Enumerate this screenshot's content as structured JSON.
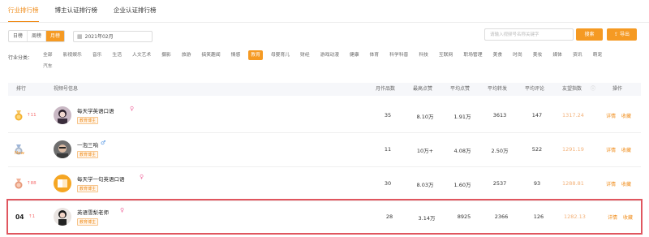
{
  "tabs": [
    "行业排行榜",
    "博主认证排行榜",
    "企业认证排行榜"
  ],
  "period": {
    "options": [
      "日榜",
      "周榜",
      "月榜"
    ],
    "selected": "月榜",
    "date": "2021年02月"
  },
  "search": {
    "placeholder": "请输入视频号名称关键字",
    "button": "搜索",
    "export": "导出"
  },
  "categories": {
    "label": "行业分类：",
    "selected": "教育",
    "items": [
      "全部",
      "影视娱乐",
      "音乐",
      "生活",
      "人文艺术",
      "摄影",
      "旅游",
      "搞笑趣闻",
      "情感",
      "教育",
      "母婴育儿",
      "财经",
      "游戏动漫",
      "健康",
      "体育",
      "科学科普",
      "科技",
      "互联网",
      "职场管理",
      "美食",
      "时尚",
      "美妆",
      "媒体",
      "资讯",
      "萌宠",
      "汽车"
    ]
  },
  "table": {
    "headers": {
      "rank": "排行",
      "info": "视频号信息",
      "works": "月作品数",
      "max_likes": "最高点赞",
      "avg_likes": "平均点赞",
      "avg_shares": "平均转发",
      "avg_comments": "平均评论",
      "index": "友望指数",
      "ops": "操作"
    },
    "index_help_icon": "question-circle-icon",
    "actions": {
      "detail": "详情",
      "favorite": "收藏"
    },
    "rows": [
      {
        "rank_icon": "gold-medal-icon",
        "change": "↑11",
        "name": "每天学英语口语",
        "gender": "♀",
        "tag": "教育博主",
        "works": "35",
        "max_likes": "8.10万",
        "avg_likes": "1.91万",
        "avg_shares": "3613",
        "avg_comments": "147",
        "index": "1317.24"
      },
      {
        "rank_icon": "silver-medal-icon",
        "change": "New",
        "name": "一泡三响",
        "gender": "♂",
        "tag": "教育博主",
        "works": "11",
        "max_likes": "10万+",
        "avg_likes": "4.08万",
        "avg_shares": "2.50万",
        "avg_comments": "522",
        "index": "1291.19"
      },
      {
        "rank_icon": "bronze-medal-icon",
        "change": "↑88",
        "name": "每天学一句英语口语",
        "gender": "♀",
        "tag": "教育博主",
        "works": "30",
        "max_likes": "8.03万",
        "avg_likes": "1.60万",
        "avg_shares": "2537",
        "avg_comments": "93",
        "index": "1288.81"
      },
      {
        "rank": "04",
        "change": "↑1",
        "name": "英语雪梨老师",
        "gender": "♀",
        "tag": "教育博主",
        "works": "28",
        "max_likes": "3.14万",
        "avg_likes": "8925",
        "avg_shares": "2366",
        "avg_comments": "126",
        "index": "1282.13"
      }
    ]
  },
  "colors": {
    "accent": "#f59a23",
    "highlight_border": "#e0565f",
    "score": "#f3b27a",
    "up": "#f56c6c"
  }
}
